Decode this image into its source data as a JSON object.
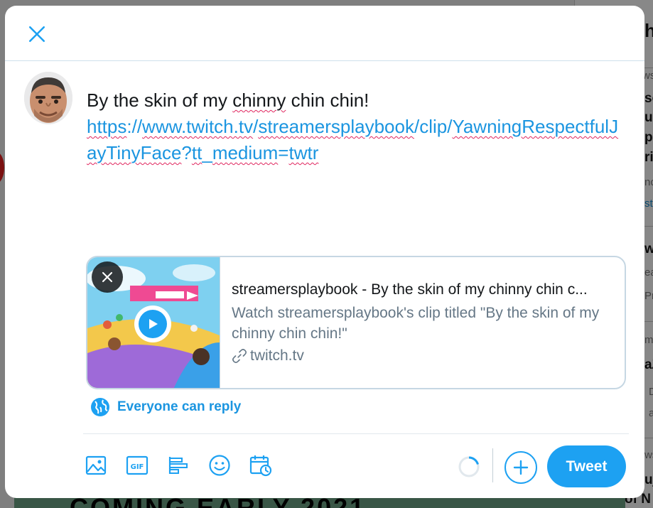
{
  "background": {
    "fragments": [
      "h",
      "ws",
      "se",
      "u",
      "pc",
      "ri",
      "nc",
      "st",
      "w",
      "ea",
      "Pr",
      "mi",
      "aZ",
      "D",
      "a",
      "ws",
      "uj",
      "of N"
    ],
    "banner_text": "COMING EARLY 2021"
  },
  "modal": {
    "compose": {
      "line1": "By the skin of my chinny chin chin!",
      "link_parts": [
        "https",
        "://",
        "www.twitch.tv",
        "/",
        "streamersplaybook",
        "/clip/",
        "YawningRespectfulJayTinyFace",
        "?",
        "tt",
        "_",
        "medium",
        "=",
        "twtr"
      ]
    },
    "card": {
      "title": "streamersplaybook - By the skin of my chinny chin c...",
      "description": "Watch streamersplaybook's clip titled \"By the skin of my chinny chin chin!\"",
      "domain": "twitch.tv"
    },
    "reply_setting": "Everyone can reply",
    "toolbar": {
      "icons": [
        "media-icon",
        "gif-icon",
        "poll-icon",
        "emoji-icon",
        "schedule-icon"
      ],
      "tweet_label": "Tweet"
    }
  },
  "colors": {
    "accent": "#1da1f2",
    "link": "#1b95e0",
    "text": "#14171a",
    "muted": "#657786"
  }
}
